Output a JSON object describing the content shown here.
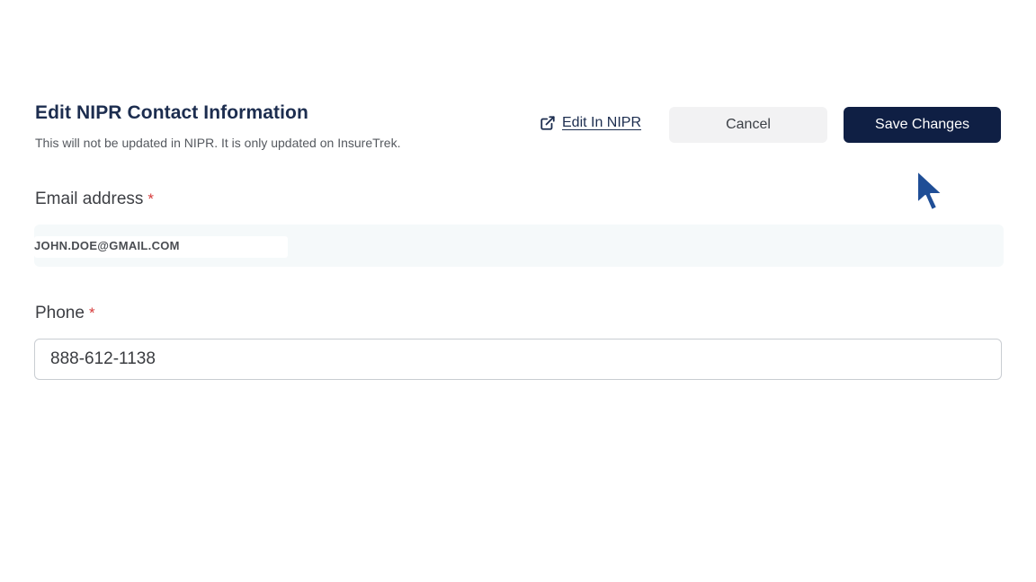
{
  "header": {
    "title": "Edit NIPR Contact Information",
    "subtitle": "This will not be updated in NIPR. It is only updated on InsureTrek."
  },
  "actions": {
    "edit_link_label": "Edit In NIPR",
    "edit_link_icon": "external-link-icon",
    "cancel_label": "Cancel",
    "save_label": "Save Changes"
  },
  "form": {
    "email": {
      "label": "Email address",
      "required_marker": "*",
      "value": "JOHN.DOE@GMAIL.COM"
    },
    "phone": {
      "label": "Phone",
      "required_marker": "*",
      "value": "888-612-1138"
    }
  },
  "colors": {
    "primary_navy": "#0f1f44",
    "title_navy": "#1c2d4f",
    "required_red": "#d63b3b",
    "cancel_bg": "#f2f2f3",
    "email_field_bg": "#f5f9fa",
    "cursor_blue": "#1f4e96"
  },
  "cursor": {
    "icon": "mouse-pointer-icon"
  }
}
